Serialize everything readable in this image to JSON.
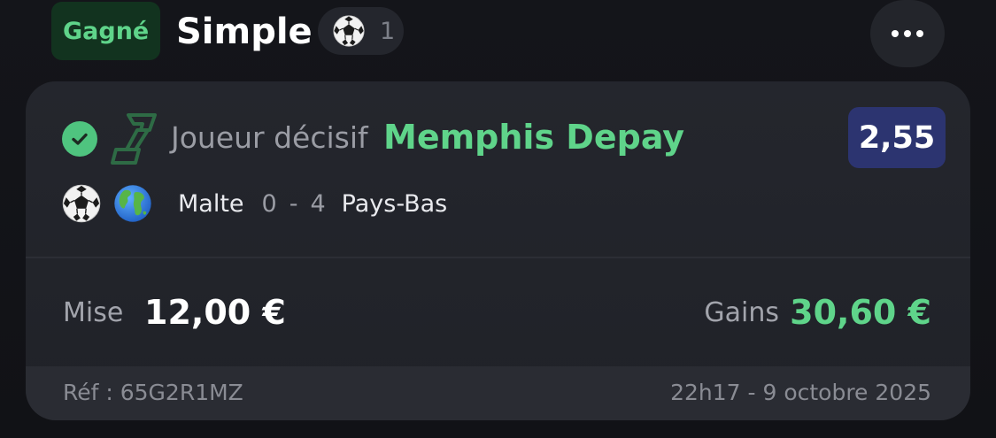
{
  "header": {
    "status": "Gagné",
    "bet_type": "Simple",
    "selection_count": "1",
    "sport_icon": "soccer-ball-icon",
    "more_icon": "more-horizontal-icon"
  },
  "selection": {
    "status_icon": "check-circle-icon",
    "market_icon": "decisive-player-icon",
    "market": "Joueur décisif",
    "name": "Memphis Depay",
    "odds": "2,55"
  },
  "event": {
    "sport_icon": "soccer-ball-icon",
    "competition_icon": "globe-icon",
    "home_team": "Malte",
    "home_score": "0",
    "separator": "-",
    "away_score": "4",
    "away_team": "Pays-Bas"
  },
  "summary": {
    "stake_label": "Mise",
    "stake_value": "12,00 €",
    "winnings_label": "Gains",
    "winnings_value": "30,60 €"
  },
  "footer": {
    "reference": "Réf : 65G2R1MZ",
    "timestamp": "22h17 - 9 octobre 2025"
  },
  "colors": {
    "win_green": "#5fd48a",
    "odds_blue": "#2c3470",
    "card_bg": "#24262d",
    "page_bg": "#111216"
  }
}
